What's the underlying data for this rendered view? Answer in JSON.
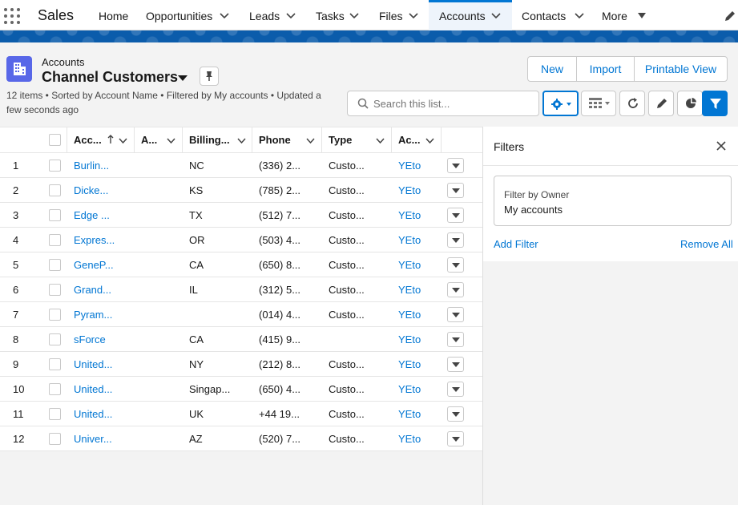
{
  "app": {
    "name": "Sales"
  },
  "nav": {
    "tabs": [
      {
        "label": "Home"
      },
      {
        "label": "Opportunities"
      },
      {
        "label": "Leads"
      },
      {
        "label": "Tasks"
      },
      {
        "label": "Files"
      },
      {
        "label": "Accounts"
      },
      {
        "label": "Contacts"
      },
      {
        "label": "More"
      }
    ],
    "active_tab": "Accounts"
  },
  "header": {
    "object_label": "Accounts",
    "list_title": "Channel Customers",
    "meta": "12 items • Sorted by Account Name • Filtered by My accounts • Updated a few seconds ago",
    "buttons": {
      "new": "New",
      "import": "Import",
      "printable": "Printable View"
    },
    "search_placeholder": "Search this list..."
  },
  "table": {
    "columns": [
      {
        "label": "Acc..."
      },
      {
        "label": "A..."
      },
      {
        "label": "Billing..."
      },
      {
        "label": "Phone"
      },
      {
        "label": "Type"
      },
      {
        "label": "Ac..."
      }
    ],
    "rows": [
      {
        "num": "1",
        "name": "Burlin...",
        "state": "NC",
        "phone": "(336) 2...",
        "type": "Custo...",
        "owner": "YEto"
      },
      {
        "num": "2",
        "name": "Dicke...",
        "state": "KS",
        "phone": "(785) 2...",
        "type": "Custo...",
        "owner": "YEto"
      },
      {
        "num": "3",
        "name": "Edge ...",
        "state": "TX",
        "phone": "(512) 7...",
        "type": "Custo...",
        "owner": "YEto"
      },
      {
        "num": "4",
        "name": "Expres...",
        "state": "OR",
        "phone": "(503) 4...",
        "type": "Custo...",
        "owner": "YEto"
      },
      {
        "num": "5",
        "name": "GeneP...",
        "state": "CA",
        "phone": "(650) 8...",
        "type": "Custo...",
        "owner": "YEto"
      },
      {
        "num": "6",
        "name": "Grand...",
        "state": "IL",
        "phone": "(312) 5...",
        "type": "Custo...",
        "owner": "YEto"
      },
      {
        "num": "7",
        "name": "Pyram...",
        "state": "",
        "phone": "(014) 4...",
        "type": "Custo...",
        "owner": "YEto"
      },
      {
        "num": "8",
        "name": "sForce",
        "state": "CA",
        "phone": "(415) 9...",
        "type": "",
        "owner": "YEto"
      },
      {
        "num": "9",
        "name": "United...",
        "state": "NY",
        "phone": "(212) 8...",
        "type": "Custo...",
        "owner": "YEto"
      },
      {
        "num": "10",
        "name": "United...",
        "state": "Singap...",
        "phone": "(650) 4...",
        "type": "Custo...",
        "owner": "YEto"
      },
      {
        "num": "11",
        "name": "United...",
        "state": "UK",
        "phone": "+44 19...",
        "type": "Custo...",
        "owner": "YEto"
      },
      {
        "num": "12",
        "name": "Univer...",
        "state": "AZ",
        "phone": "(520) 7...",
        "type": "Custo...",
        "owner": "YEto"
      }
    ]
  },
  "filters": {
    "title": "Filters",
    "owner_label": "Filter by Owner",
    "owner_value": "My accounts",
    "add_filter": "Add Filter",
    "remove_all": "Remove All"
  },
  "colors": {
    "brand": "#0176d3",
    "object_icon": "#5867e8"
  }
}
